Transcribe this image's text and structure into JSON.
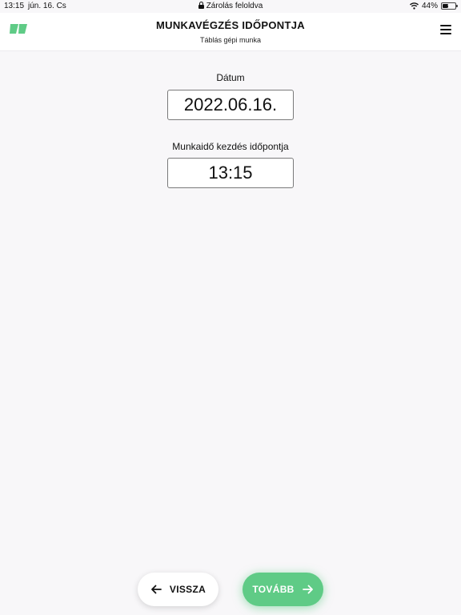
{
  "status_bar": {
    "time": "13:15",
    "date": "jún. 16. Cs",
    "center_text": "Zárolás feloldva",
    "battery": "44%",
    "battery_level": 0.44
  },
  "header": {
    "title": "MUNKAVÉGZÉS IDŐPONTJA",
    "subtitle": "Táblás gépi munka",
    "logo_color": "#5fcb86"
  },
  "form": {
    "date_label": "Dátum",
    "date_value": "2022.06.16.",
    "start_label": "Munkaidő kezdés időpontja",
    "start_value": "13:15"
  },
  "footer": {
    "back_label": "VISSZA",
    "next_label": "TOVÁBB",
    "accent": "#5fcb86"
  }
}
